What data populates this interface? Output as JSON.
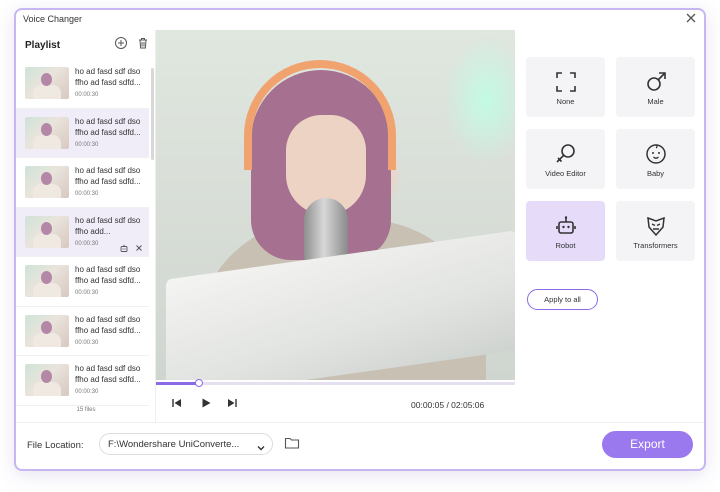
{
  "window": {
    "title": "Voice  Changer"
  },
  "playlist": {
    "title": "Playlist",
    "count_label": "15 files",
    "items": [
      {
        "text": "ho ad fasd sdf dso ffho ad fasd sdfd...",
        "duration": "00:00:30"
      },
      {
        "text": "ho ad fasd sdf dso ffho ad fasd sdfd...",
        "duration": "00:00:30"
      },
      {
        "text": "ho ad fasd sdf dso ffho ad fasd sdfd...",
        "duration": "00:00:30"
      },
      {
        "text": "ho ad fasd sdf dso  ffho add...",
        "duration": "00:00:30"
      },
      {
        "text": "ho ad fasd sdf dso ffho ad fasd sdfd...",
        "duration": "00:00:30"
      },
      {
        "text": "ho ad fasd sdf dso ffho ad fasd sdfd...",
        "duration": "00:00:30"
      },
      {
        "text": "ho ad fasd sdf dso ffho ad fasd sdfd...",
        "duration": "00:00:30"
      }
    ]
  },
  "player": {
    "current_time": "00:00:05",
    "total_time": "02:05:06",
    "time_readout": "00:00:05 / 02:05:06",
    "progress": 0.12
  },
  "effects": [
    {
      "label": "None",
      "icon": "none-frame-icon",
      "selected": false
    },
    {
      "label": "Male",
      "icon": "male-symbol-icon",
      "selected": false
    },
    {
      "label": "Video Editor",
      "icon": "female-symbol-icon",
      "selected": false
    },
    {
      "label": "Baby",
      "icon": "baby-face-icon",
      "selected": false
    },
    {
      "label": "Robot",
      "icon": "robot-icon",
      "selected": true
    },
    {
      "label": "Transformers",
      "icon": "transformer-icon",
      "selected": false
    }
  ],
  "apply_all_label": "Apply to all",
  "footer": {
    "file_location_label": "File Location:",
    "file_location_value": "F:\\Wondershare UniConverte...",
    "export_label": "Export"
  },
  "colors": {
    "accent": "#8b6ae6",
    "export_button": "#9a78ee",
    "selected_effect": "#e6dcfa",
    "selected_row": "#f0edf9"
  }
}
